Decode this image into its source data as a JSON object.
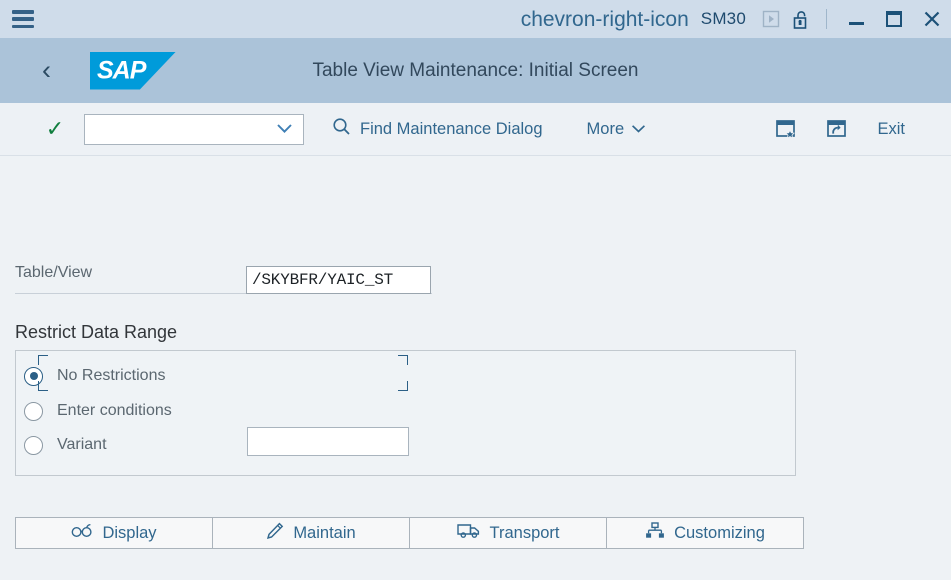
{
  "window": {
    "menu_icon": "hamburger-icon",
    "expand_icon": "chevron-right-icon",
    "transaction_code": "SM30",
    "run_icon": "play-icon",
    "lock_icon": "unlocked-padlock-icon",
    "minimize_label": "Minimize",
    "maximize_label": "Maximize",
    "close_label": "✕"
  },
  "header": {
    "back_icon": "‹",
    "logo_text": "SAP",
    "title": "Table View Maintenance: Initial Screen"
  },
  "toolbar": {
    "confirm_icon": "✓",
    "combo_value": "",
    "combo_caret": "∨",
    "find_label": "Find Maintenance Dialog",
    "find_icon": "search-icon",
    "more_label": "More",
    "more_caret": "∨",
    "favorite_icon": "add-to-favorites-icon",
    "shortcut_icon": "create-shortcut-icon",
    "exit_label": "Exit"
  },
  "form": {
    "table_view_label": "Table/View",
    "table_view_value": "/SKYBFR/YAIC_ST",
    "table_view_placeholder": "",
    "section_title": "Restrict Data Range",
    "options": [
      {
        "label": "No Restrictions",
        "selected": true
      },
      {
        "label": "Enter conditions",
        "selected": false
      },
      {
        "label": "Variant",
        "selected": false
      }
    ],
    "variant_value": "",
    "variant_placeholder": ""
  },
  "actions": [
    {
      "label": "Display",
      "icon": "glasses-icon"
    },
    {
      "label": "Maintain",
      "icon": "pencil-icon"
    },
    {
      "label": "Transport",
      "icon": "truck-icon"
    },
    {
      "label": "Customizing",
      "icon": "hierarchy-icon"
    }
  ],
  "colors": {
    "titlebar_bg": "#cfdcea",
    "header_bg": "#abc3d9",
    "content_bg": "#eef2f5",
    "accent_blue": "#31678e",
    "sap_logo_blue": "#009bda",
    "confirm_green": "#107e3e"
  }
}
